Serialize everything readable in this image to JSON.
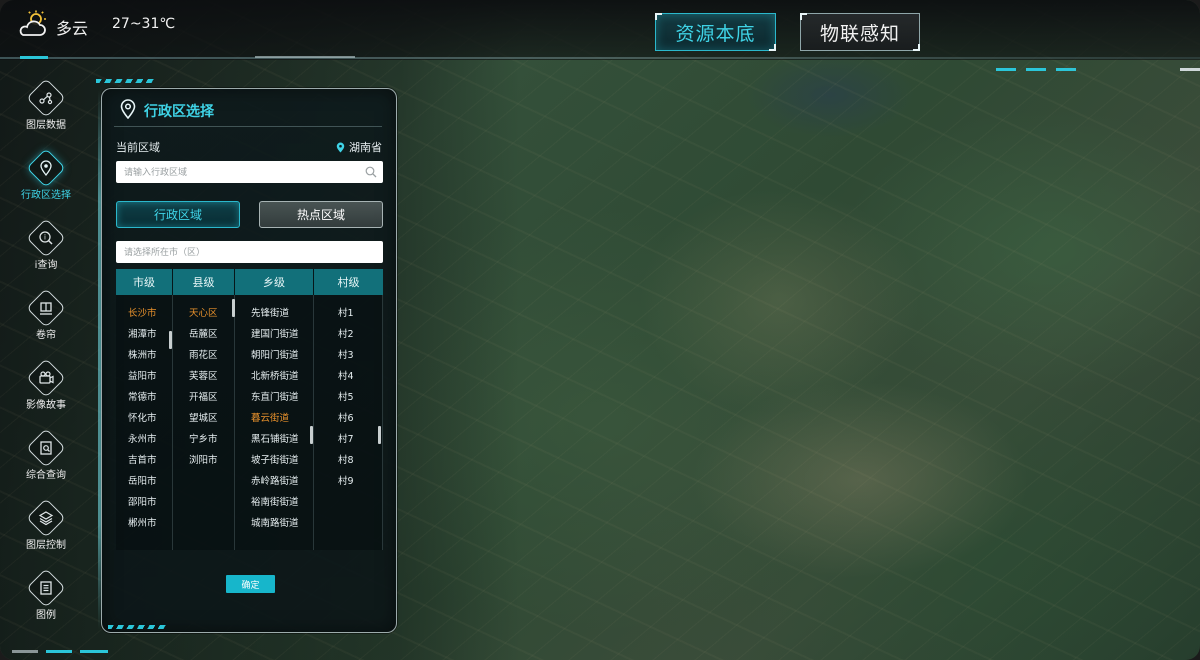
{
  "topbar": {
    "weather_icon": "partly-cloudy-icon",
    "weather": "多云",
    "temperature": "27~31℃",
    "tabs": [
      {
        "label": "资源本底",
        "active": true
      },
      {
        "label": "物联感知",
        "active": false
      }
    ]
  },
  "sidebar": {
    "items": [
      {
        "label": "图层数据",
        "icon": "layer-data-icon",
        "active": false
      },
      {
        "label": "行政区选择",
        "icon": "location-pin-icon",
        "active": true
      },
      {
        "label": "i查询",
        "icon": "info-query-icon",
        "active": false
      },
      {
        "label": "卷帘",
        "icon": "swipe-icon",
        "active": false
      },
      {
        "label": "影像故事",
        "icon": "camera-story-icon",
        "active": false
      },
      {
        "label": "综合查询",
        "icon": "search-doc-icon",
        "active": false
      },
      {
        "label": "图层控制",
        "icon": "layers-icon",
        "active": false
      },
      {
        "label": "图例",
        "icon": "legend-icon",
        "active": false
      }
    ]
  },
  "panel": {
    "title": "行政区选择",
    "current_area_label": "当前区域",
    "current_area_value": "湖南省",
    "search_placeholder": "请输入行政区域",
    "segments": {
      "admin": "行政区域",
      "hotspot": "热点区域"
    },
    "city_placeholder": "请选择所在市（区）",
    "table": {
      "headers": [
        "市级",
        "县级",
        "乡级",
        "村级"
      ],
      "cities": [
        "长沙市",
        "湘潭市",
        "株洲市",
        "益阳市",
        "常德市",
        "怀化市",
        "永州市",
        "吉首市",
        "岳阳市",
        "邵阳市",
        "郴州市"
      ],
      "counties": [
        "天心区",
        "岳麓区",
        "雨花区",
        "芙蓉区",
        "开福区",
        "望城区",
        "宁乡市",
        "浏阳市"
      ],
      "towns": [
        "先锋街道",
        "建国门街道",
        "朝阳门街道",
        "北新桥街道",
        "东直门街道",
        "暮云街道",
        "黑石铺街道",
        "坡子街街道",
        "赤岭路街道",
        "裕南街街道",
        "城南路街道"
      ],
      "villages": [
        "村1",
        "村2",
        "村3",
        "村4",
        "村5",
        "村6",
        "村7",
        "村8",
        "村9"
      ],
      "selected": {
        "city": 0,
        "county": 0,
        "town": 5
      }
    },
    "confirm_label": "确定"
  },
  "colors": {
    "accent": "#2bc6d9",
    "selected": "#e8912c",
    "header": "#12707a"
  }
}
